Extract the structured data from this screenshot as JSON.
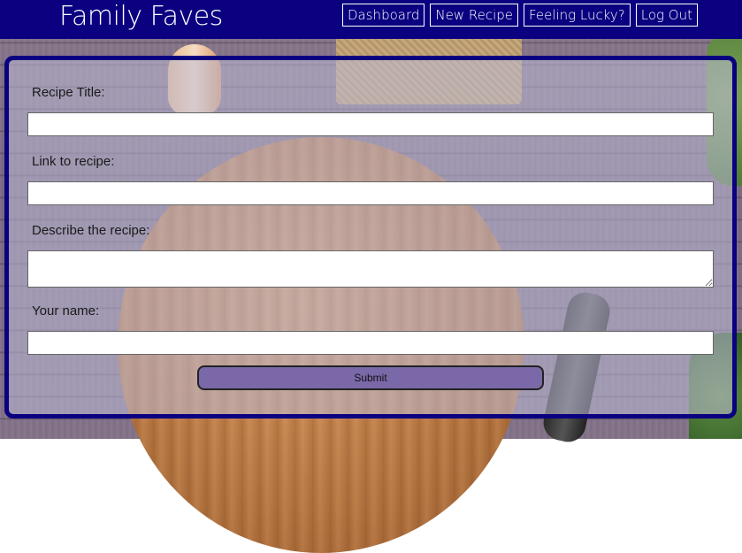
{
  "app": {
    "title": "Family Faves"
  },
  "nav": {
    "items": [
      {
        "label": "Dashboard"
      },
      {
        "label": "New Recipe"
      },
      {
        "label": "Feeling Lucky?"
      },
      {
        "label": "Log Out"
      }
    ]
  },
  "form": {
    "title_label": "Recipe Title:",
    "title_value": "",
    "link_label": "Link to recipe:",
    "link_value": "",
    "description_label": "Describe the recipe:",
    "description_value": "",
    "name_label": "Your name:",
    "name_value": "",
    "submit_label": "Submit"
  },
  "colors": {
    "header_bg": "#0a0080",
    "card_border": "#0a0080",
    "submit_bg": "#7a68a8"
  }
}
